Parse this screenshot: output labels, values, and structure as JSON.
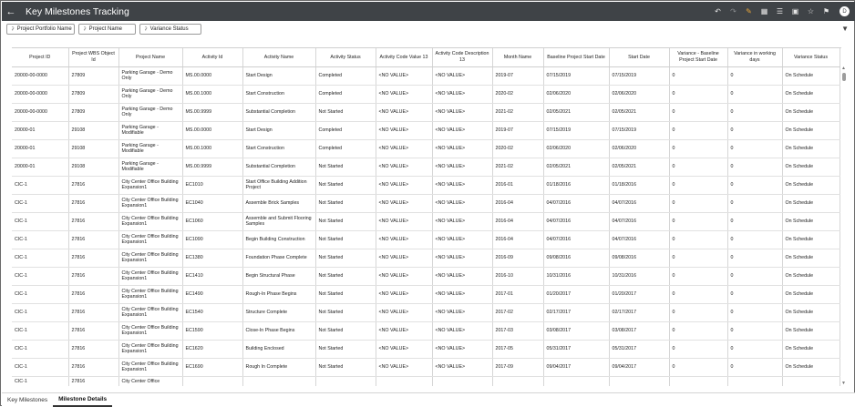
{
  "window": {
    "title": "Key Milestones Tracking",
    "avatar_letter": "D"
  },
  "toolbar": {
    "icons": [
      "undo-icon",
      "redo-icon",
      "edit-icon",
      "data-icon",
      "messages-icon",
      "present-icon",
      "share-icon",
      "bookmark-icon"
    ]
  },
  "filters": [
    {
      "label": "Project Portfolio Name"
    },
    {
      "label": "Project Name"
    },
    {
      "label": "Variance Status"
    }
  ],
  "table": {
    "columns": [
      "Project ID",
      "Project WBS Object Id",
      "Project Name",
      "Activity Id",
      "Activity Name",
      "Activity Status",
      "Activity Code Value 13",
      "Activity Code Description 13",
      "Month Name",
      "Baseline Project Start Date",
      "Start Date",
      "Variance - Baseline Project Start Date",
      "Variance in working days",
      "Variance Status"
    ],
    "rows": [
      [
        "20000-00-0000",
        "27809",
        "Parking Garage - Demo Only",
        "MS.00.0000",
        "Start Design",
        "Completed",
        "<NO VALUE>",
        "<NO VALUE>",
        "2019-07",
        "07/15/2019",
        "07/15/2019",
        "0",
        "0",
        "On Schedule"
      ],
      [
        "20000-00-0000",
        "27809",
        "Parking Garage - Demo Only",
        "MS.00.1000",
        "Start Construction",
        "Completed",
        "<NO VALUE>",
        "<NO VALUE>",
        "2020-02",
        "02/06/2020",
        "02/06/2020",
        "0",
        "0",
        "On Schedule"
      ],
      [
        "20000-00-0000",
        "27809",
        "Parking Garage - Demo Only",
        "MS.00.9999",
        "Substantial Completion",
        "Not Started",
        "<NO VALUE>",
        "<NO VALUE>",
        "2021-02",
        "02/05/2021",
        "02/05/2021",
        "0",
        "0",
        "On Schedule"
      ],
      [
        "20000-01",
        "29108",
        "Parking Garage - Modifiable",
        "MS.00.0000",
        "Start Design",
        "Completed",
        "<NO VALUE>",
        "<NO VALUE>",
        "2019-07",
        "07/15/2019",
        "07/15/2019",
        "0",
        "0",
        "On Schedule"
      ],
      [
        "20000-01",
        "29108",
        "Parking Garage - Modifiable",
        "MS.00.1000",
        "Start Construction",
        "Completed",
        "<NO VALUE>",
        "<NO VALUE>",
        "2020-02",
        "02/06/2020",
        "02/06/2020",
        "0",
        "0",
        "On Schedule"
      ],
      [
        "20000-01",
        "29108",
        "Parking Garage - Modifiable",
        "MS.00.9999",
        "Substantial Completion",
        "Not Started",
        "<NO VALUE>",
        "<NO VALUE>",
        "2021-02",
        "02/05/2021",
        "02/05/2021",
        "0",
        "0",
        "On Schedule"
      ],
      [
        "CIC-1",
        "27816",
        "City Center Office Building Expansion1",
        "EC1010",
        "Start Office Building Addition Project",
        "Not Started",
        "<NO VALUE>",
        "<NO VALUE>",
        "2016-01",
        "01/18/2016",
        "01/18/2016",
        "0",
        "0",
        "On Schedule"
      ],
      [
        "CIC-1",
        "27816",
        "City Center Office Building Expansion1",
        "EC1040",
        "Assemble Brick Samples",
        "Not Started",
        "<NO VALUE>",
        "<NO VALUE>",
        "2016-04",
        "04/07/2016",
        "04/07/2016",
        "0",
        "0",
        "On Schedule"
      ],
      [
        "CIC-1",
        "27816",
        "City Center Office Building Expansion1",
        "EC1060",
        "Assemble and Submit Flooring Samples",
        "Not Started",
        "<NO VALUE>",
        "<NO VALUE>",
        "2016-04",
        "04/07/2016",
        "04/07/2016",
        "0",
        "0",
        "On Schedule"
      ],
      [
        "CIC-1",
        "27816",
        "City Center Office Building Expansion1",
        "EC1090",
        "Begin Building Construction",
        "Not Started",
        "<NO VALUE>",
        "<NO VALUE>",
        "2016-04",
        "04/07/2016",
        "04/07/2016",
        "0",
        "0",
        "On Schedule"
      ],
      [
        "CIC-1",
        "27816",
        "City Center Office Building Expansion1",
        "EC1380",
        "Foundation Phase Complete",
        "Not Started",
        "<NO VALUE>",
        "<NO VALUE>",
        "2016-09",
        "09/08/2016",
        "09/08/2016",
        "0",
        "0",
        "On Schedule"
      ],
      [
        "CIC-1",
        "27816",
        "City Center Office Building Expansion1",
        "EC1410",
        "Begin Structural Phase",
        "Not Started",
        "<NO VALUE>",
        "<NO VALUE>",
        "2016-10",
        "10/31/2016",
        "10/31/2016",
        "0",
        "0",
        "On Schedule"
      ],
      [
        "CIC-1",
        "27816",
        "City Center Office Building Expansion1",
        "EC1490",
        "Rough-In Phase Begins",
        "Not Started",
        "<NO VALUE>",
        "<NO VALUE>",
        "2017-01",
        "01/20/2017",
        "01/20/2017",
        "0",
        "0",
        "On Schedule"
      ],
      [
        "CIC-1",
        "27816",
        "City Center Office Building Expansion1",
        "EC1540",
        "Structure Complete",
        "Not Started",
        "<NO VALUE>",
        "<NO VALUE>",
        "2017-02",
        "02/17/2017",
        "02/17/2017",
        "0",
        "0",
        "On Schedule"
      ],
      [
        "CIC-1",
        "27816",
        "City Center Office Building Expansion1",
        "EC1590",
        "Close-In Phase Begins",
        "Not Started",
        "<NO VALUE>",
        "<NO VALUE>",
        "2017-03",
        "03/08/2017",
        "03/08/2017",
        "0",
        "0",
        "On Schedule"
      ],
      [
        "CIC-1",
        "27816",
        "City Center Office Building Expansion1",
        "EC1620",
        "Building Enclosed",
        "Not Started",
        "<NO VALUE>",
        "<NO VALUE>",
        "2017-05",
        "05/31/2017",
        "05/31/2017",
        "0",
        "0",
        "On Schedule"
      ],
      [
        "CIC-1",
        "27816",
        "City Center Office Building Expansion1",
        "EC1690",
        "Rough In Complete",
        "Not Started",
        "<NO VALUE>",
        "<NO VALUE>",
        "2017-09",
        "09/04/2017",
        "09/04/2017",
        "0",
        "0",
        "On Schedule"
      ],
      [
        "CIC-1",
        "27816",
        "City Center Office",
        "",
        "",
        "",
        "",
        "",
        "",
        "",
        "",
        "",
        "",
        ""
      ]
    ]
  },
  "tabs": [
    {
      "label": "Key Milestones",
      "active": false
    },
    {
      "label": "Milestone Details",
      "active": true
    }
  ]
}
